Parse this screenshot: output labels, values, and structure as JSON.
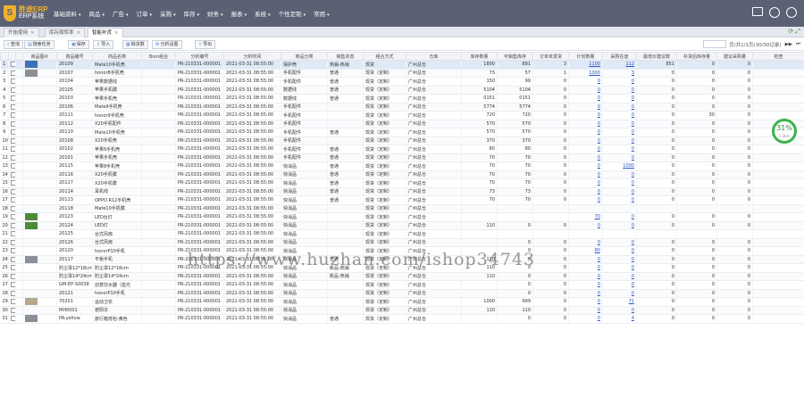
{
  "header": {
    "logo_mark": "S",
    "logo_title": "胜途ERP",
    "logo_sub": "ERP系统",
    "nav": [
      "基础资料",
      "商品",
      "广告",
      "订单",
      "采购",
      "库存",
      "财务",
      "报表",
      "系统",
      "个性定制",
      "常用"
    ],
    "icons": [
      "monitor-icon",
      "user-icon",
      "help-icon"
    ]
  },
  "tabs": [
    {
      "label": "开始使用",
      "close": "×"
    },
    {
      "label": "库存周转率",
      "close": "×"
    },
    {
      "label": "智能补货",
      "close": "×"
    }
  ],
  "toolbar": {
    "buttons": [
      "查询",
      "搜索任务",
      "保存",
      "导入",
      "缺货数",
      "分析设置",
      "导出"
    ],
    "pager_text": "页/共1/1页(30/30记录)"
  },
  "grid": {
    "columns": [
      "",
      "",
      "",
      "商品图片",
      "商品编号",
      "商品名称",
      "Bom组合",
      "分析编号",
      "分析时间",
      "商品分类",
      "销售状态",
      "组合方式",
      "仓库",
      "库存数量",
      "可销售库存",
      "订单未发货",
      "计划数量",
      "采购在途",
      "最低价建议数",
      "补货后库存量",
      "建议采购量",
      "检查"
    ],
    "rows": [
      [
        "1",
        "",
        "img-blue",
        "20109",
        "Mate10手机壳",
        "",
        "PR-210331-000001",
        "2021-03-31 08:55:00",
        "保护壳",
        "热销-热销",
        "现货",
        "广州总仓",
        "1800",
        "891",
        "3",
        "1100",
        "112",
        "851",
        "0",
        "0",
        ""
      ],
      [
        "2",
        "",
        "img-gray",
        "20107",
        "honor8手机壳",
        "",
        "PR-210331-000001",
        "2021-03-31 08:55:00",
        "手机配件",
        "普通",
        "现货（定制）",
        "广州总仓",
        "73",
        "57",
        "1",
        "1000",
        "3",
        "0",
        "0",
        "0",
        ""
      ],
      [
        "3",
        "",
        "",
        "20104",
        "苹果数据线",
        "",
        "PR-210331-000001",
        "2021-03-31 08:55:00",
        "手机配件",
        "普通",
        "现货（定制）",
        "广州总仓",
        "150",
        "99",
        "0",
        "0",
        "0",
        "0",
        "0",
        "0",
        ""
      ],
      [
        "4",
        "",
        "",
        "20105",
        "苹果手机膜",
        "",
        "PR-210331-000001",
        "2021-03-31 08:55:00",
        "数据线",
        "普通",
        "现货（定制）",
        "广州总仓",
        "5104",
        "5104",
        "0",
        "0",
        "0",
        "0",
        "0",
        "0",
        ""
      ],
      [
        "5",
        "",
        "",
        "20103",
        "苹果手机壳",
        "",
        "PR-210331-000001",
        "2021-03-31 08:55:00",
        "数据线",
        "普通",
        "现货（定制）",
        "广州总仓",
        "0151",
        "0151",
        "0",
        "0",
        "0",
        "0",
        "0",
        "0",
        ""
      ],
      [
        "6",
        "",
        "",
        "20106",
        "Mate9手机壳",
        "",
        "PR-210331-000001",
        "2021-03-31 08:55:00",
        "手机配件",
        "",
        "现货（定制）",
        "广州总仓",
        "5774",
        "5774",
        "0",
        "0",
        "0",
        "0",
        "0",
        "0",
        ""
      ],
      [
        "7",
        "",
        "",
        "20111",
        "honor9手机壳",
        "",
        "PR-210331-000001",
        "2021-03-31 08:55:00",
        "手机配件",
        "",
        "现货（定制）",
        "广州总仓",
        "720",
        "720",
        "0",
        "0",
        "0",
        "0",
        "30",
        "0",
        ""
      ],
      [
        "8",
        "",
        "",
        "20112",
        "X20手机配件",
        "",
        "PR-210331-000001",
        "2021-03-31 08:55:00",
        "手机配件",
        "",
        "现货（定制）",
        "广州总仓",
        "570",
        "570",
        "0",
        "0",
        "0",
        "0",
        "0",
        "0",
        ""
      ],
      [
        "9",
        "",
        "",
        "20110",
        "Mate10手机壳",
        "",
        "PR-210331-000001",
        "2021-03-31 08:55:00",
        "手机配件",
        "普通",
        "现货（定制）",
        "广州总仓",
        "570",
        "570",
        "0",
        "0",
        "0",
        "0",
        "0",
        "0",
        ""
      ],
      [
        "10",
        "",
        "",
        "20108",
        "X20手机壳",
        "",
        "PR-210331-000001",
        "2021-03-31 08:55:00",
        "手机配件",
        "",
        "现货（定制）",
        "广州总仓",
        "370",
        "370",
        "0",
        "0",
        "0",
        "0",
        "0",
        "0",
        ""
      ],
      [
        "11",
        "",
        "",
        "20102",
        "苹果6手机壳",
        "",
        "PR-210331-000001",
        "2021-03-31 08:55:00",
        "手机配件",
        "普通",
        "现货（定制）",
        "广州总仓",
        "80",
        "80",
        "0",
        "0",
        "0",
        "0",
        "0",
        "0",
        ""
      ],
      [
        "12",
        "",
        "",
        "20101",
        "苹果手机壳",
        "",
        "PR-210331-000001",
        "2021-03-31 08:55:00",
        "手机配件",
        "普通",
        "现货（定制）",
        "广州总仓",
        "70",
        "70",
        "0",
        "0",
        "0",
        "0",
        "0",
        "0",
        ""
      ],
      [
        "13",
        "",
        "",
        "20115",
        "苹果8手机壳",
        "",
        "PR-210331-000001",
        "2021-03-31 08:55:00",
        "快消品",
        "普通",
        "现货（定制）",
        "广州总仓",
        "70",
        "70",
        "0",
        "0",
        "1000",
        "0",
        "0",
        "0",
        ""
      ],
      [
        "14",
        "",
        "",
        "20116",
        "X20手机膜",
        "",
        "PR-210331-000001",
        "2021-03-31 08:55:00",
        "快消品",
        "普通",
        "现货（定制）",
        "广州总仓",
        "70",
        "70",
        "0",
        "0",
        "0",
        "0",
        "0",
        "0",
        ""
      ],
      [
        "15",
        "",
        "",
        "20117",
        "X20手机膜",
        "",
        "PR-210331-000001",
        "2021-03-31 08:55:00",
        "快消品",
        "普通",
        "现货（定制）",
        "广州总仓",
        "70",
        "70",
        "0",
        "0",
        "0",
        "0",
        "0",
        "0",
        ""
      ],
      [
        "16",
        "",
        "",
        "20114",
        "耳机线",
        "",
        "PR-210331-000001",
        "2021-03-31 08:55:00",
        "快消品",
        "普通",
        "现货（定制）",
        "广州总仓",
        "73",
        "73",
        "0",
        "0",
        "0",
        "0",
        "0",
        "0",
        ""
      ],
      [
        "17",
        "",
        "",
        "20113",
        "OPPO R12手机壳",
        "",
        "PR-210331-000001",
        "2021-03-31 08:55:00",
        "快消品",
        "普通",
        "现货（定制）",
        "广州总仓",
        "70",
        "70",
        "0",
        "0",
        "0",
        "0",
        "0",
        "0",
        ""
      ],
      [
        "18",
        "",
        "",
        "20118",
        "Mate10手机膜",
        "",
        "PR-210331-000001",
        "2021-03-31 08:55:00",
        "快消品",
        "",
        "现货（定制）",
        "广州总仓",
        "",
        "",
        "",
        "",
        "",
        "",
        "",
        "",
        ""
      ],
      [
        "19",
        "",
        "img-green",
        "20123",
        "LED台灯",
        "",
        "PR-210331-000001",
        "2021-03-31 08:55:00",
        "快消品",
        "",
        "现货（定制）",
        "广州总仓",
        "",
        "",
        "",
        "70",
        "0",
        "0",
        "0",
        "0",
        ""
      ],
      [
        "20",
        "",
        "img-green",
        "20124",
        "LED灯",
        "",
        "PR-210331-000001",
        "2021-03-31 08:55:00",
        "快消品",
        "",
        "现货（定制）",
        "广州总仓",
        "110",
        "0",
        "0",
        "0",
        "0",
        "0",
        "0",
        "0",
        ""
      ],
      [
        "21",
        "",
        "",
        "20125",
        "台式风扇",
        "",
        "PR-210331-000001",
        "2021-03-31 08:55:00",
        "快消品",
        "",
        "现货（定制）",
        "广州总仓",
        "",
        "",
        "",
        "",
        "",
        "",
        "",
        "",
        ""
      ],
      [
        "22",
        "",
        "",
        "20126",
        "台式风扇",
        "",
        "PR-210331-000001",
        "2021-03-31 08:55:00",
        "快消品",
        "",
        "现货（定制）",
        "广州总仓",
        "",
        "0",
        "0",
        "0",
        "0",
        "0",
        "0",
        "0",
        ""
      ],
      [
        "23",
        "",
        "",
        "20120",
        "honorP10手机",
        "",
        "PR-210331-000001",
        "2021-03-31 08:55:00",
        "快消品",
        "",
        "现货（定制）",
        "广州总仓",
        "",
        "0",
        "0",
        "80",
        "0",
        "0",
        "0",
        "0",
        ""
      ],
      [
        "24",
        "",
        "img-gray",
        "20117",
        "平板手机",
        "",
        "PR-210331-000001",
        "2021-03-31 08:55:00",
        "快消品",
        "普通",
        "现货（定制）",
        "广州总仓",
        "110",
        "0",
        "0",
        "0",
        "0",
        "0",
        "0",
        "0",
        ""
      ],
      [
        "25",
        "",
        "",
        "防尘罩12*18cm",
        "防尘罩12*18cm",
        "",
        "PR-210331-000001",
        "2021-03-31 08:55:00",
        "快消品",
        "新品-热销",
        "现货（定制）",
        "广州总仓",
        "110",
        "0",
        "0",
        "0",
        "0",
        "0",
        "0",
        "0",
        ""
      ],
      [
        "26",
        "",
        "",
        "防尘罩14*24cm",
        "防尘罩14*24cm",
        "",
        "PR-210331-000001",
        "2021-03-31 08:55:00",
        "快消品",
        "新品-热销",
        "现货（定制）",
        "广州总仓",
        "110",
        "0",
        "0",
        "0",
        "0",
        "0",
        "0",
        "0",
        ""
      ],
      [
        "27",
        "",
        "",
        "GM-EP-S0038",
        "创意饮水器（蓝光",
        "",
        "PR-210331-000001",
        "2021-03-31 08:55:00",
        "快消品",
        "",
        "现货（定制）",
        "广州总仓",
        "",
        "0",
        "0",
        "0",
        "0",
        "0",
        "0",
        "0",
        ""
      ],
      [
        "28",
        "",
        "",
        "20121",
        "honorP10手机",
        "",
        "PR-210331-000001",
        "2021-03-31 08:55:00",
        "快消品",
        "",
        "现货（定制）",
        "广州总仓",
        "",
        "0",
        "0",
        "0",
        "0",
        "0",
        "0",
        "0",
        ""
      ],
      [
        "29",
        "",
        "img-figure",
        "70201",
        "运动卫衣",
        "",
        "PR-210331-000001",
        "2021-03-31 08:55:00",
        "快消品",
        "",
        "现货（定制）",
        "广州总仓",
        "1000",
        "999",
        "0",
        "0",
        "71",
        "0",
        "0",
        "0",
        ""
      ],
      [
        "30",
        "",
        "",
        "MH0001",
        "遮阳伞",
        "",
        "PR-210331-000001",
        "2021-03-31 08:55:00",
        "快消品",
        "",
        "现货（定制）",
        "广州总仓",
        "110",
        "110",
        "0",
        "0",
        "0",
        "0",
        "0",
        "0",
        ""
      ],
      [
        "31",
        "",
        "img-gray",
        "PA-yellow",
        "旅行箱挎包-黄色",
        "",
        "PR-210331-000001",
        "2021-03-31 08:55:00",
        "快消品",
        "普通",
        "现货（定制）",
        "广州总仓",
        "",
        "0",
        "0",
        "0",
        "4",
        "0",
        "0",
        "0",
        ""
      ]
    ]
  },
  "gauge": {
    "value": "31",
    "unit": "%",
    "sub": "1.2k/s"
  },
  "watermark": "https://www.huzhan.com/ishop34743",
  "colors": {
    "header": "#5b6175",
    "accent": "#f0b12d",
    "link": "#2a55c8",
    "gauge": "#3bb34a"
  }
}
